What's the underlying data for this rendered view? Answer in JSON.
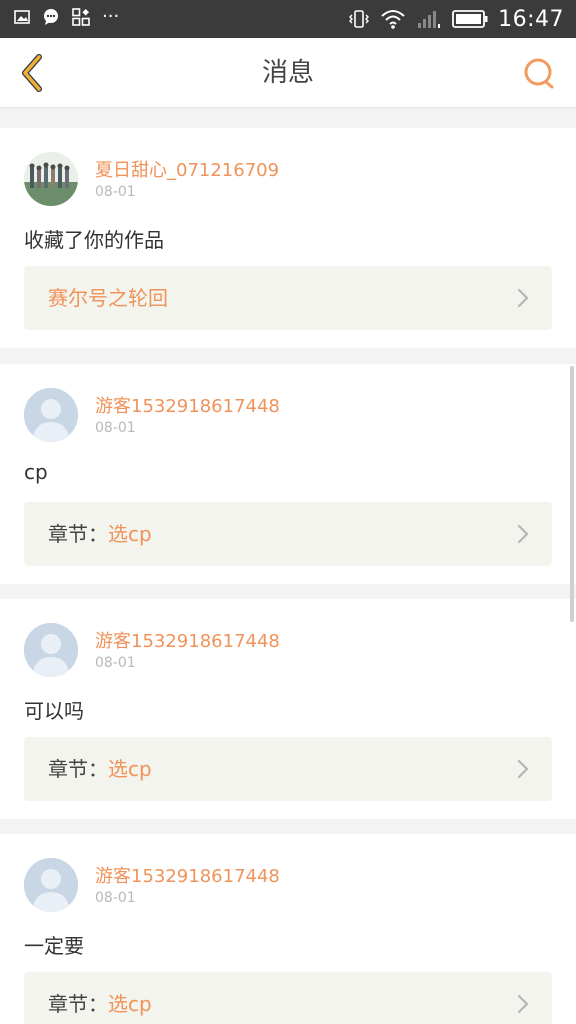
{
  "status_bar": {
    "time": "16:47",
    "left_icons": [
      "image-icon",
      "message-bubble-icon",
      "apps-icon",
      "more-dots-icon"
    ],
    "more_dots": "···",
    "right_icons": [
      "vibrate-icon",
      "wifi-icon",
      "signal-icon",
      "battery-icon"
    ]
  },
  "header": {
    "title": "消息",
    "accent_color": "#f0b03a",
    "search_color": "#f39a5f"
  },
  "messages": [
    {
      "username": "夏日甜心_071216709",
      "date": "08-01",
      "content": "收藏了你的作品",
      "ref_prefix": "",
      "ref_title": "赛尔号之轮回",
      "avatar": "photo-avatar"
    },
    {
      "username": "游客1532918617448",
      "date": "08-01",
      "content": "cp",
      "ref_prefix": "章节：",
      "ref_title": "选cp",
      "avatar": "default-avatar"
    },
    {
      "username": "游客1532918617448",
      "date": "08-01",
      "content": "可以吗",
      "ref_prefix": "章节：",
      "ref_title": "选cp",
      "avatar": "default-avatar"
    },
    {
      "username": "游客1532918617448",
      "date": "08-01",
      "content": "一定要",
      "ref_prefix": "章节：",
      "ref_title": "选cp",
      "avatar": "default-avatar"
    }
  ]
}
